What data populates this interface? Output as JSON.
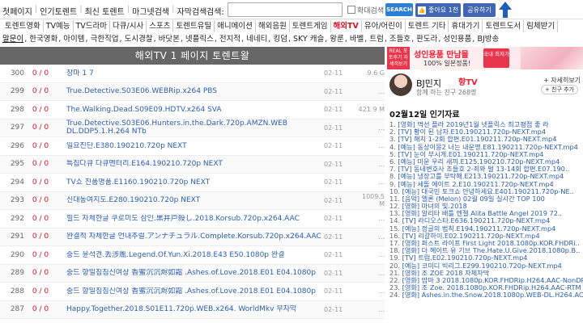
{
  "topnav": [
    "첫페이지",
    "인기토렌트",
    "최신 토렌트",
    "마그넷검색",
    "자막검색"
  ],
  "search": {
    "label": "검색:",
    "checkbox_label": "확대검색",
    "button": "SEARCH"
  },
  "facebook": {
    "like": "좋아요 1천",
    "share": "공유하기"
  },
  "categories": [
    "토렌트영화",
    "TV예능",
    "TV드라마",
    "다큐/시사",
    "스포츠",
    "토렌트유틸",
    "애니메이션",
    "해외음원",
    "토렌트게임",
    "해외TV",
    "유아/어린이",
    "토렌트 기타",
    "휴대가기",
    "토렌트도서",
    "림체받기"
  ],
  "active_category": "해외TV",
  "genres": [
    "말문이",
    "한국영화",
    "아이템",
    "극한직업",
    "도시경찰",
    "바닷본",
    "넷플릭스",
    "전지적",
    "네네티",
    "킹덤",
    "SKY 캐슬",
    "왕룬",
    "바벨",
    "트럼",
    "조들호",
    "판도라",
    "성인용품",
    "BJ방송"
  ],
  "list": {
    "header": "해외TV 1 페이지 토렌트왈",
    "rows": [
      {
        "num": "300",
        "seeds": "0 / 0",
        "title": "장마 1 7",
        "date": "02-11",
        "size": "9.6 G"
      },
      {
        "num": "299",
        "seeds": "0 / 0",
        "title": "True.Detective.S03E06.WEBRip.x264 PBS",
        "date": "02-11",
        "size": "..."
      },
      {
        "num": "298",
        "seeds": "0 / 0",
        "title": "The.Walking.Dead.S09E09.HDTV.x264 SVA",
        "date": "02-11",
        "size": "421.9 M"
      },
      {
        "num": "297",
        "seeds": "0 / 0",
        "title": "True.Detective.S03E06.Hunters.in.the.Dark.720p.AMZN.WEB DL.DDP5.1.H.264 NTb",
        "date": "02-11",
        "size": "..."
      },
      {
        "num": "296",
        "seeds": "0 / 0",
        "title": "일요진단.E380.190210.720p NEXT",
        "date": "02-11",
        "size": "..."
      },
      {
        "num": "295",
        "seeds": "0 / 0",
        "title": "특집다큐 다큐멘터리.E164.190210.720p NEXT",
        "date": "02-11",
        "size": "..."
      },
      {
        "num": "294",
        "seeds": "0 / 0",
        "title": "TV쇼 진품명품.E1160.190210.720p NEXT",
        "date": "02-11",
        "size": "..."
      },
      {
        "num": "293",
        "seeds": "0 / 0",
        "title": "신대동여지도.E280.190210.720p NEXT",
        "date": "02-11",
        "size": "1009.5 M"
      },
      {
        "num": "292",
        "seeds": "0 / 0",
        "title": "힐드 자체한글 쿠로미도 삼인.黒井戸殺し.2018.Korsub.720p.x264.AAC",
        "date": "02-11",
        "size": "..."
      },
      {
        "num": "291",
        "seeds": "0 / 0",
        "title": "완결적 자체한글 언내추럴.アンナチュラル.Complete.Korsub.720p.x264.AAC",
        "date": "02-11",
        "size": "..."
      },
      {
        "num": "290",
        "seeds": "0 / 0",
        "title": "중드 윤석견.丢涉胤.Legend.Of.Yun.Xi.2018.E43 E50.1080p 완결",
        "date": "02-11",
        "size": "..."
      },
      {
        "num": "289",
        "seeds": "0 / 0",
        "title": "중드 향밀침침신여상 香蜜沉沉烬如霜 .Ashes.of.Love.2018.E01 E04.1080p",
        "date": "02-11",
        "size": "..."
      },
      {
        "num": "288",
        "seeds": "0 / 0",
        "title": "중드 향밀침침신여상 香蜜沉沉烬如霜 .Ashes.of.Love.2018.E01 E04.1080p",
        "date": "02-11",
        "size": "..."
      },
      {
        "num": "287",
        "seeds": "0 / 0",
        "title": "Happy.Together.2018.S01E11.720p.WEB.x264. WorldMkv 무자막",
        "date": "02-11",
        "size": "..."
      }
    ]
  },
  "banner": {
    "left": "REAL 포토후기 자세히보기",
    "main": "성인용품 만남몰",
    "sub": "100% 일본정품!",
    "tag": "국내 최저가"
  },
  "profile": {
    "name": "BJ민지",
    "logo": "향TV",
    "sub": "함께 하는 친구 268명",
    "more": "+ 자세히보기",
    "fan": "+ 친구 추가"
  },
  "popular": {
    "title": "02월12일 인기자료",
    "items": [
      "[영화] 먹선 플라 2019년1월 넷플릭스 최고평점 좋 라",
      "[TV] 황이 된 남자.E10.190211.720p-NEXT.mp4",
      "[TV] 해치 1-2회 합편.E01.190211.720p-NEXT.mp4",
      "[예능] 동상이몽2 너는 내운명.E81.190211.720p-NEXT.mp4",
      "[TV] 눈이 부시게.E01.190211.720p-NEXT.mp4",
      "[예능] 미운 우리 새끼.E125.190210.720p-NEXT.mp4",
      "[TV] 동네변호사 조들호 2-죄와 벌 13-14회 합편.E07.190..",
      "[예능] 냉장고를 부탁해.E213.190211.720p-NEXT.mp4",
      "[예능] 세돌 에이트 2.E10.190211.720p-NEXT.mp4",
      "[예능] 대국민 토크쇼 안녕하세요.E401.190211.720p-NE..",
      "[음악] 멜론 (Melon) 02월 09일 실시간 TOP 100",
      "[영화] 마녀의 빛.2018",
      "[영화] 알리타 배틀 엔젤 Alita Battle Angel 2019 72..",
      "[TV] 라디오스타.E636.190211.720p-NEXT.mp4",
      "[예능] 정글의 법칙.E194.190211.720p-NEXT.mp4",
      "[TV] 리갈하이.E02.190211.720p-NEXT.mp4",
      "[영화] 퍼스트 라이프 First Light 2018.1080p.KOR.FHDRi..",
      "[영화] 더 헤이트 유 기브 The.Hate.U.Give.2018.1080p.B..",
      "[TV] 트럼.E02.190210.720p-NEXT.mp4",
      "[예능] 코미디 빅리그.E299.190210.720p-NEXT.mp4",
      "[영화] 조 ZOE 2018 자체자막",
      "[영화] 맘마 3 2018.1080p.KOR.FHDRip.H264.AAC-NonDRM",
      "[영화] 조 Zoe. 2018.1080p.KOR.FHDRip.H264.AAC-RTM",
      "[영화] Ashes.in.the.Snow.2018.1080p.WEB-DL.H264.AC3-EVO"
    ]
  }
}
